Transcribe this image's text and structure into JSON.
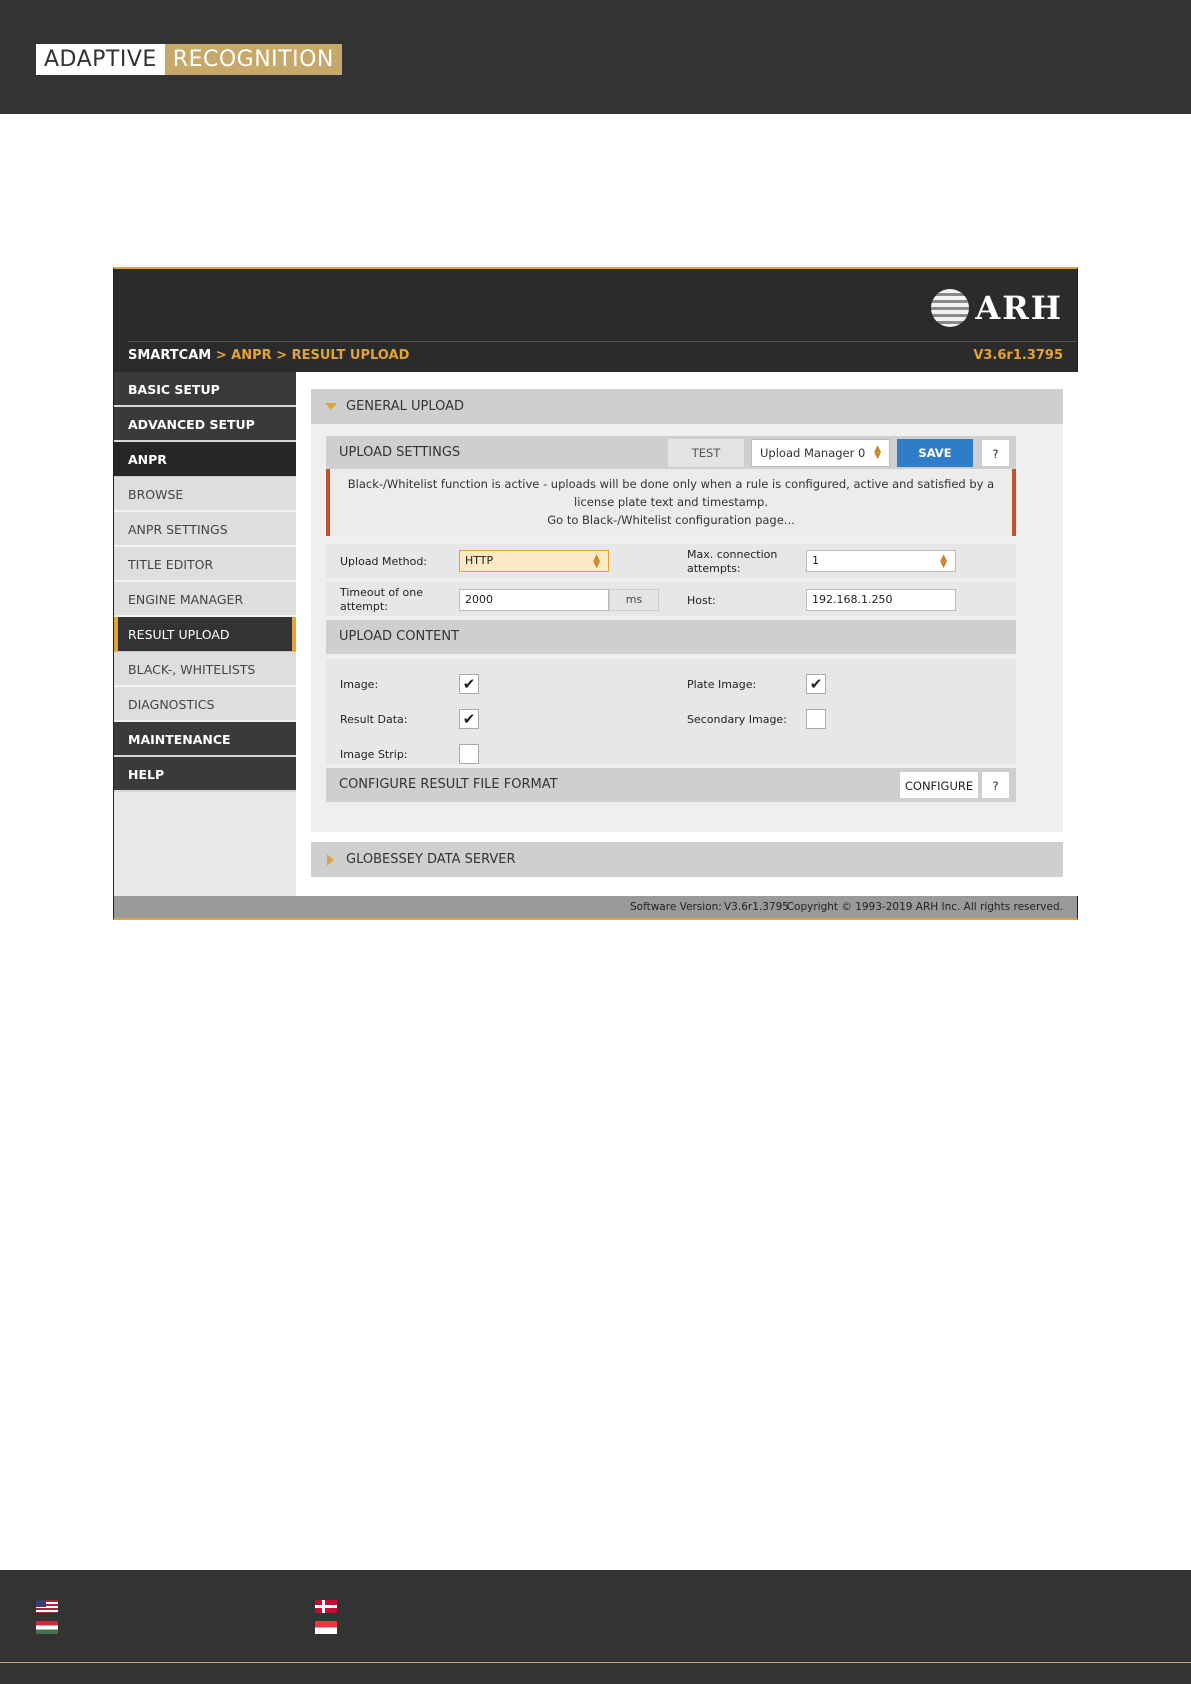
{
  "brand": {
    "left": "ADAPTIVE",
    "right": "RECOGNITION"
  },
  "app": {
    "logo_text": "ARH",
    "breadcrumb": {
      "root": "SMARTCAM",
      "path": " > ANPR > RESULT UPLOAD"
    },
    "version": "V3.6r1.3795"
  },
  "sidebar": {
    "items": [
      {
        "label": "BASIC SETUP"
      },
      {
        "label": "ADVANCED SETUP"
      },
      {
        "label": "ANPR"
      },
      {
        "label": "BROWSE"
      },
      {
        "label": "ANPR SETTINGS"
      },
      {
        "label": "TITLE EDITOR"
      },
      {
        "label": "ENGINE MANAGER"
      },
      {
        "label": "RESULT UPLOAD"
      },
      {
        "label": "BLACK-, WHITELISTS"
      },
      {
        "label": "DIAGNOSTICS"
      },
      {
        "label": "MAINTENANCE"
      },
      {
        "label": "HELP"
      }
    ]
  },
  "general_upload": {
    "title": "GENERAL UPLOAD",
    "upload_settings": {
      "title": "UPLOAD SETTINGS",
      "test_label": "TEST",
      "manager_value": "Upload Manager 0",
      "save_label": "SAVE",
      "help_label": "?"
    },
    "alert": {
      "message": "Black-/Whitelist function is active - uploads will be done only when a rule is configured, active and satisfied by a license plate text and timestamp.",
      "link": "Go to Black-/Whitelist configuration page..."
    },
    "fields": {
      "upload_method": {
        "label": "Upload Method:",
        "value": "HTTP"
      },
      "max_attempts": {
        "label": "Max. connection attempts:",
        "value": "1"
      },
      "timeout": {
        "label": "Timeout of one attempt:",
        "value": "2000",
        "unit": "ms"
      },
      "host": {
        "label": "Host:",
        "value": "192.168.1.250"
      }
    },
    "upload_content": {
      "title": "UPLOAD CONTENT",
      "image": {
        "label": "Image:",
        "checked": true
      },
      "plate_image": {
        "label": "Plate Image:",
        "checked": true
      },
      "result_data": {
        "label": "Result Data:",
        "checked": true
      },
      "secondary_image": {
        "label": "Secondary Image:",
        "checked": false
      },
      "image_strip": {
        "label": "Image Strip:",
        "checked": false
      },
      "check_glyph": "✔"
    },
    "file_format": {
      "title": "CONFIGURE RESULT FILE FORMAT",
      "configure_label": "CONFIGURE",
      "help_label": "?"
    }
  },
  "globessey": {
    "title": "GLOBESSEY DATA SERVER"
  },
  "status_bar": {
    "software_label": "Software Version:",
    "software_value": "V3.6r1.3795",
    "copyright": "Copyright © 1993-2019 ARH Inc. All rights reserved."
  },
  "colors": {
    "accent": "#e2a33b",
    "header": "#2b2b2b",
    "save_button": "#2f7dc8",
    "alert_border": "#c0522b",
    "brand_gold": "#c5a86a"
  },
  "icons": [
    "ball-logo-icon",
    "triangle-down-icon",
    "triangle-right-icon",
    "select-caret-icon",
    "checkmark-icon",
    "flag-us-icon",
    "flag-dk-icon",
    "flag-hu-icon",
    "flag-sg-icon"
  ]
}
